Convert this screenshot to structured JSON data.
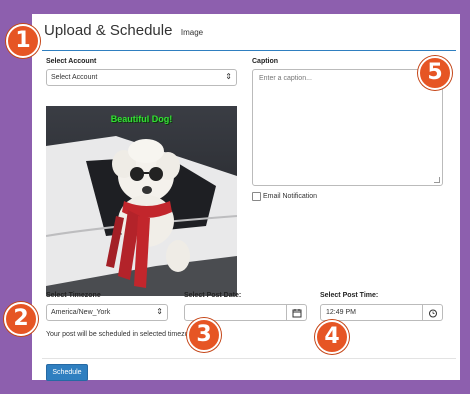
{
  "header": {
    "title": "Upload & Schedule",
    "subtitle": "Image"
  },
  "account": {
    "label": "Select Account",
    "selected": "Select Account"
  },
  "image": {
    "overlay_text": "Beautiful Dog!"
  },
  "caption": {
    "label": "Caption",
    "placeholder": "Enter a caption..."
  },
  "email_notification": {
    "label": "Email Notification",
    "checked": false
  },
  "timezone": {
    "label": "Select Timezone",
    "selected": "America/New_York",
    "note": "Your post will be scheduled in selected timezone."
  },
  "post_date": {
    "label": "Select Post Date:",
    "value": ""
  },
  "post_time": {
    "label": "Select Post Time:",
    "value": "12:49 PM"
  },
  "schedule_button": {
    "label": "Schedule"
  },
  "badges": [
    "1",
    "2",
    "3",
    "4",
    "5"
  ],
  "colors": {
    "frame": "#8d5fae",
    "accent": "#2f7fc0",
    "badge": "#e65524",
    "overlay_text": "#33e033"
  }
}
